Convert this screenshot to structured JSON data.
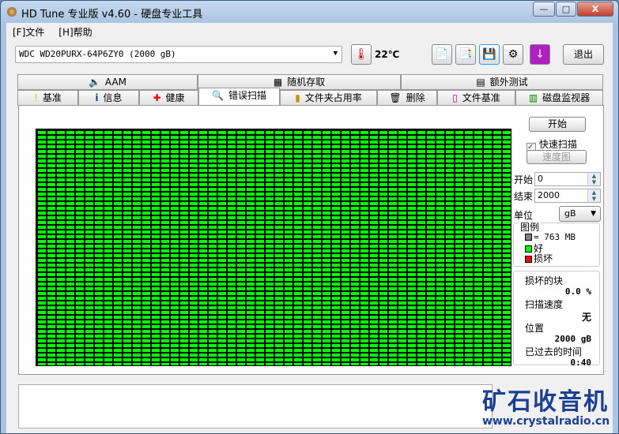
{
  "window": {
    "title": "HD Tune 专业版 v4.60 - 硬盘专业工具",
    "minimize": "—",
    "maximize": "□",
    "close": "X"
  },
  "menu": [
    "[F]文件",
    "[H]帮助"
  ],
  "toolbar": {
    "drive": "WDC WD20PURX-64P6ZY0 (2000 gB)",
    "temperature": "22℃",
    "exit": "退出"
  },
  "tabs_top": [
    {
      "label": "AAM",
      "icon": "speaker-icon"
    },
    {
      "label": "随机存取",
      "icon": "scatter-icon"
    },
    {
      "label": "额外测试",
      "icon": "calculator-icon"
    }
  ],
  "tabs_bottom": [
    {
      "label": "基准",
      "icon": "exclamation-icon"
    },
    {
      "label": "信息",
      "icon": "info-icon"
    },
    {
      "label": "健康",
      "icon": "red-cross-icon"
    },
    {
      "label": "错误扫描",
      "icon": "magnifier-icon"
    },
    {
      "label": "文件夹占用率",
      "icon": "folder-icon"
    },
    {
      "label": "删除",
      "icon": "trash-icon"
    },
    {
      "label": "文件基准",
      "icon": "file-icon"
    },
    {
      "label": "磁盘监视器",
      "icon": "chart-icon"
    }
  ],
  "scan": {
    "start_button": "开始",
    "quick_scan_label": "快速扫描",
    "quick_scan_checked": true,
    "speed_map_button": "速度图",
    "start_label": "开始",
    "start_value": "0",
    "end_label": "结束",
    "end_value": "2000",
    "unit_label": "单位",
    "unit_value": "gB"
  },
  "legend": {
    "title": "图例",
    "block_size": "= 763 MB",
    "good": "好",
    "bad": "损坏",
    "colors": {
      "block": "#808080",
      "good": "#00ff00",
      "bad": "#ff0000"
    }
  },
  "stats": {
    "damaged_label": "损坏的块",
    "damaged_value": "0.0 %",
    "speed_label": "扫描速度",
    "speed_value": "无",
    "position_label": "位置",
    "position_value": "2000 gB",
    "elapsed_label": "已过去的时间",
    "elapsed_value": "0:40"
  },
  "watermark": {
    "cn": "矿石收音机",
    "url": "www.crystalradio.cn"
  }
}
